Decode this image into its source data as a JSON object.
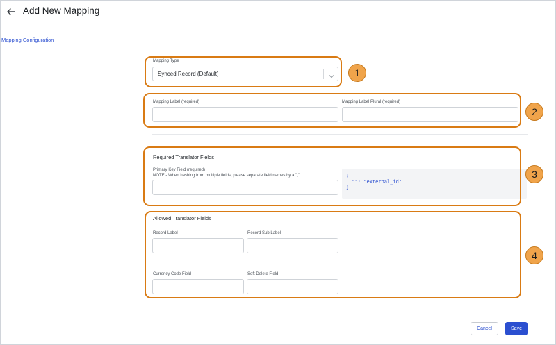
{
  "header": {
    "title": "Add New Mapping"
  },
  "tabs": [
    {
      "label": "Mapping Configuration"
    }
  ],
  "mapping_type": {
    "label": "Mapping Type",
    "value": "Synced Record (Default)"
  },
  "mapping_label": {
    "label": "Mapping Label (required)",
    "value": ""
  },
  "mapping_label_plural": {
    "label": "Mapping Label Plural (required)",
    "value": ""
  },
  "required_fields": {
    "title": "Required Translator Fields",
    "primary_key_label": "Primary Key Field (required)",
    "primary_key_note": "NOTE - When hashing from multiple fields, please separate field names by a \",\"",
    "primary_key_value": "",
    "code_lines": [
      "{",
      "  \"\": \"external_id\"",
      "}"
    ]
  },
  "allowed_fields": {
    "title": "Allowed Translator Fields",
    "record_label": "Record Label",
    "record_sub_label": "Record Sub Label",
    "currency_code_field": "Currency Code Field",
    "soft_delete_field": "Soft Delete Field"
  },
  "callouts": [
    "1",
    "2",
    "3",
    "4"
  ],
  "footer": {
    "cancel_label": "Cancel",
    "save_label": "Save"
  },
  "colors": {
    "accent": "#2b4fd0",
    "callout_border": "#d97b14",
    "callout_fill": "#f0a44b"
  },
  "icons": {
    "back": "arrow-left-icon",
    "dropdown": "chevron-down-icon"
  }
}
